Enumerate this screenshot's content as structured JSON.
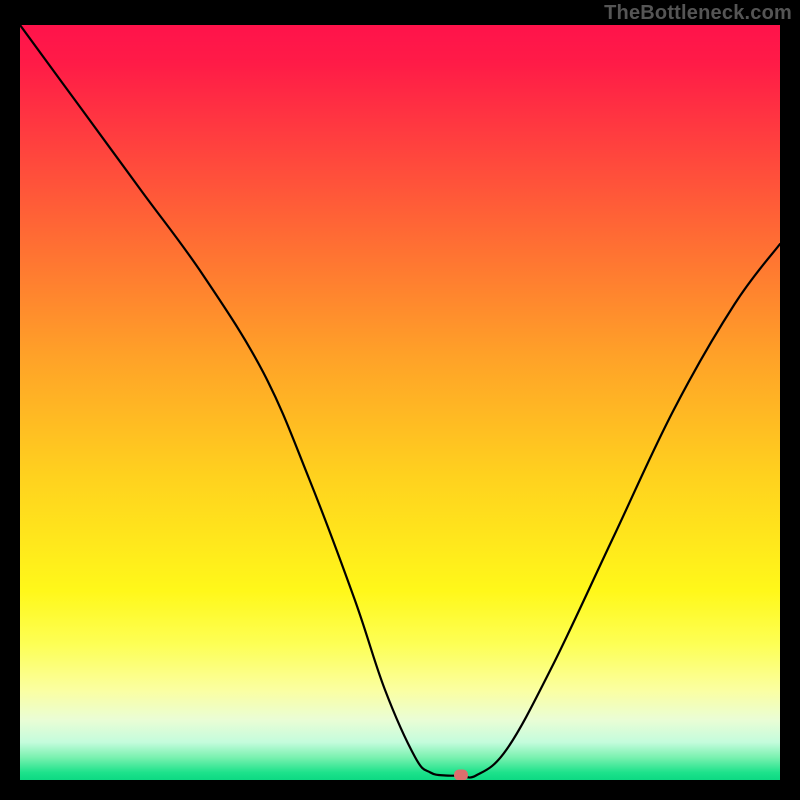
{
  "watermark": "TheBottleneck.com",
  "chart_data": {
    "type": "line",
    "title": "",
    "xlabel": "",
    "ylabel": "",
    "xlim": [
      0,
      100
    ],
    "ylim": [
      0,
      100
    ],
    "grid": false,
    "legend": false,
    "marker": {
      "x": 58,
      "y": 0.6
    },
    "series": [
      {
        "name": "bottleneck-curve",
        "x": [
          0,
          8,
          16,
          24,
          32,
          38,
          44,
          48,
          52,
          54,
          56,
          58,
          60,
          64,
          70,
          78,
          86,
          94,
          100
        ],
        "values": [
          100,
          89,
          78,
          67,
          54,
          40,
          24,
          12,
          3,
          1,
          0.6,
          0.6,
          0.6,
          4,
          15,
          32,
          49,
          63,
          71
        ]
      }
    ]
  }
}
